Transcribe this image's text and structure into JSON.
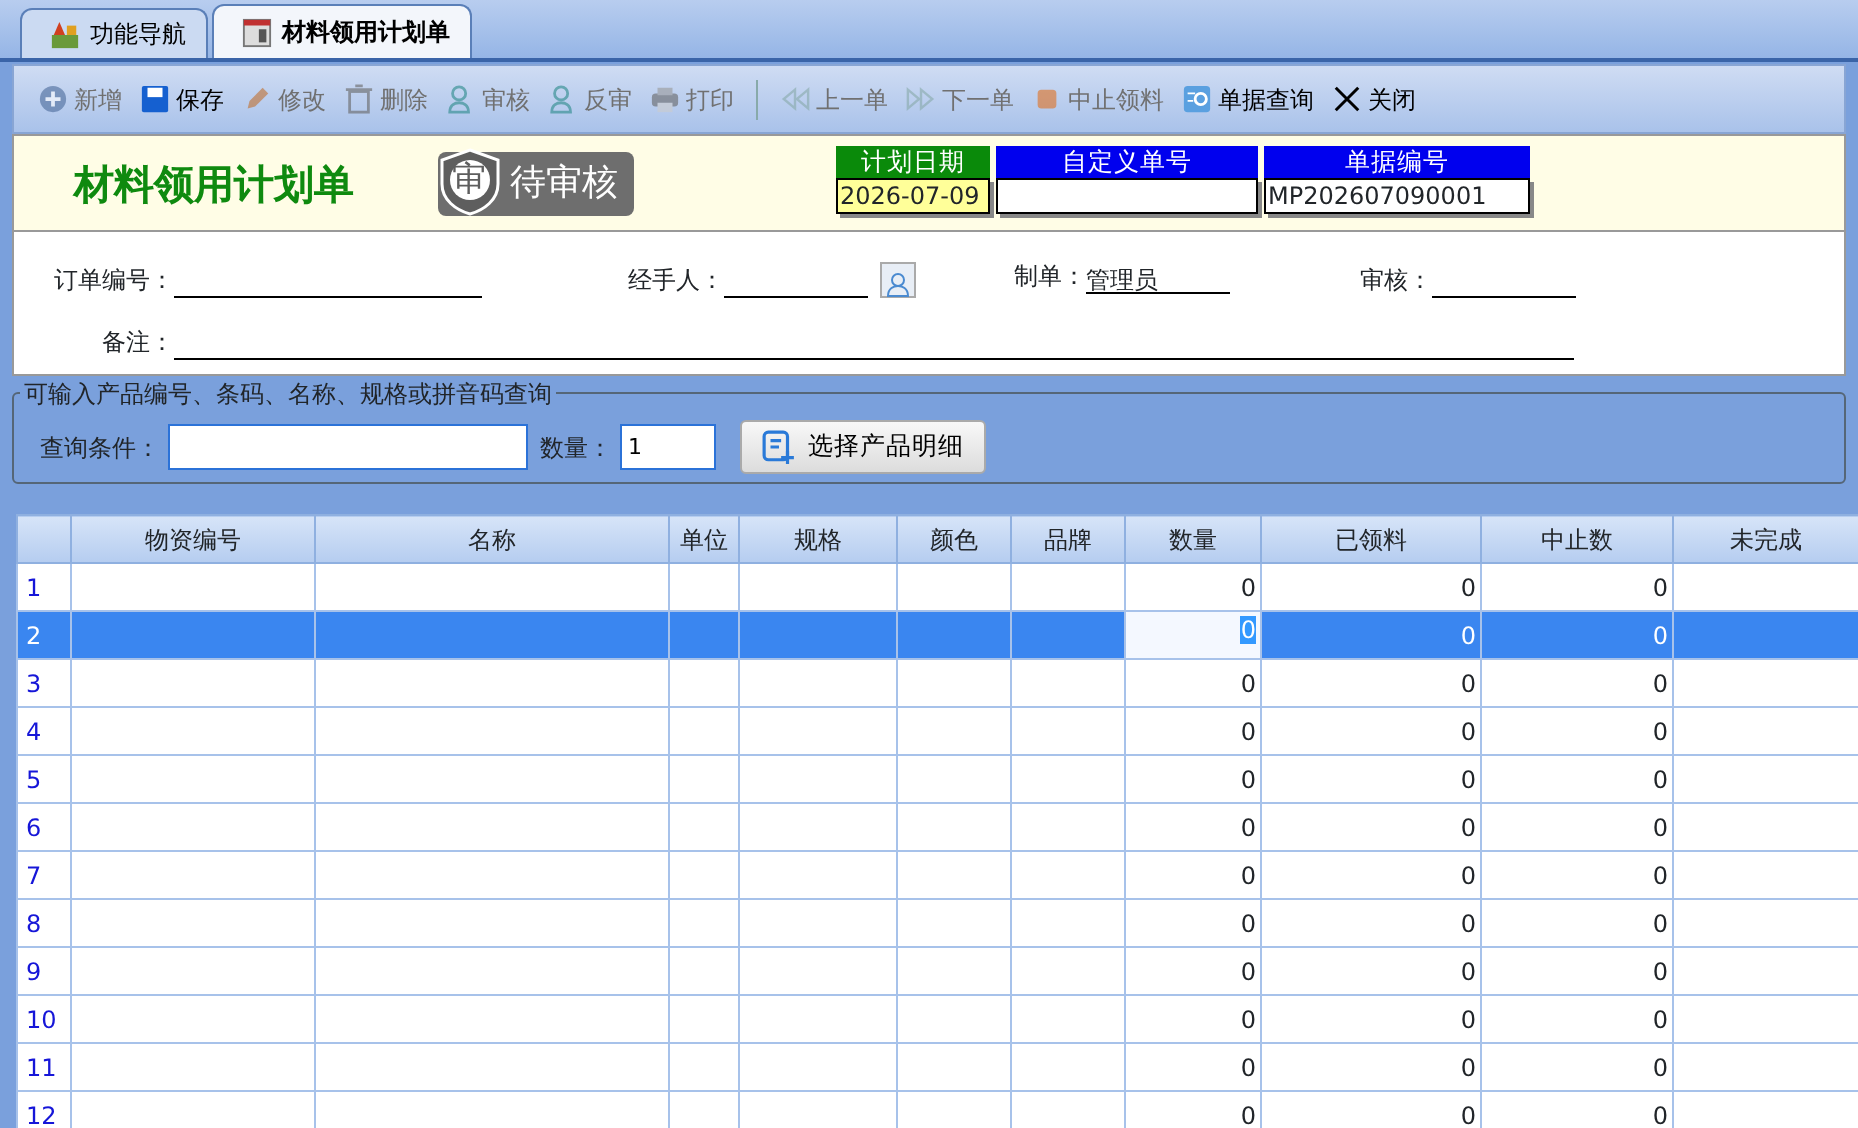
{
  "tabs": [
    {
      "label": "功能导航",
      "selected": false
    },
    {
      "label": "材料领用计划单",
      "selected": true
    }
  ],
  "toolbar": [
    {
      "label": "新增",
      "disabled": true
    },
    {
      "label": "保存",
      "disabled": false
    },
    {
      "label": "修改",
      "disabled": true
    },
    {
      "label": "删除",
      "disabled": true
    },
    {
      "label": "审核",
      "disabled": true
    },
    {
      "label": "反审",
      "disabled": true
    },
    {
      "label": "打印",
      "disabled": true
    },
    {
      "label": "上一单",
      "disabled": true
    },
    {
      "label": "下一单",
      "disabled": true
    },
    {
      "label": "中止领料",
      "disabled": true
    },
    {
      "label": "单据查询",
      "disabled": false
    },
    {
      "label": "关闭",
      "disabled": false
    }
  ],
  "header": {
    "title": "材料领用计划单",
    "status": "待审核",
    "status_icon_char": "审",
    "fields": [
      {
        "label": "计划日期",
        "value": "2026-07-09",
        "kind": "date"
      },
      {
        "label": "自定义单号",
        "kind": "text"
      },
      {
        "label": "单据编号",
        "value": "MP202607090001",
        "kind": "text"
      }
    ]
  },
  "form": {
    "order_no": {
      "label": "订单编号："
    },
    "handler": {
      "label": "经手人："
    },
    "maker": {
      "label": "制单：",
      "value": "管理员"
    },
    "reviewer": {
      "label": "审核："
    },
    "remark": {
      "label": "备注："
    }
  },
  "query": {
    "legend": "可输入产品编号、条码、名称、规格或拼音码查询",
    "condition_label": "查询条件：",
    "quantity_label": "数量：",
    "quantity": "1",
    "button": "选择产品明细"
  },
  "table": {
    "columns": [
      "物资编号",
      "名称",
      "单位",
      "规格",
      "颜色",
      "品牌",
      "数量",
      "已领料",
      "中止数",
      "未完成"
    ],
    "rows": [
      {
        "index": "1",
        "quantity": "0",
        "received": "0",
        "stopped": "0",
        "selected": false
      },
      {
        "index": "2",
        "quantity": "0",
        "received": "0",
        "stopped": "0",
        "selected": true
      },
      {
        "index": "3",
        "quantity": "0",
        "received": "0",
        "stopped": "0",
        "selected": false
      },
      {
        "index": "4",
        "quantity": "0",
        "received": "0",
        "stopped": "0",
        "selected": false
      },
      {
        "index": "5",
        "quantity": "0",
        "received": "0",
        "stopped": "0",
        "selected": false
      },
      {
        "index": "6",
        "quantity": "0",
        "received": "0",
        "stopped": "0",
        "selected": false
      },
      {
        "index": "7",
        "quantity": "0",
        "received": "0",
        "stopped": "0",
        "selected": false
      },
      {
        "index": "8",
        "quantity": "0",
        "received": "0",
        "stopped": "0",
        "selected": false
      },
      {
        "index": "9",
        "quantity": "0",
        "received": "0",
        "stopped": "0",
        "selected": false
      },
      {
        "index": "10",
        "quantity": "0",
        "received": "0",
        "stopped": "0",
        "selected": false
      },
      {
        "index": "11",
        "quantity": "0",
        "received": "0",
        "stopped": "0",
        "selected": false
      },
      {
        "index": "12",
        "quantity": "0",
        "received": "0",
        "stopped": "0",
        "selected": false
      }
    ]
  }
}
